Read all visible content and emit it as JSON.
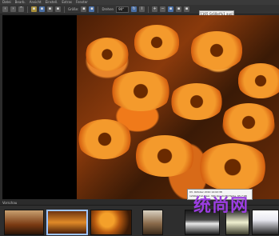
{
  "menu": {
    "items": [
      "Datei",
      "Bearb.",
      "Ansicht",
      "Einstell.",
      "Extras",
      "Fenster"
    ]
  },
  "toolbar": {
    "size_label": "Größe:",
    "rotate_label": "Drehen",
    "rotate_value": "90°"
  },
  "viewer": {
    "zoom_badge": "1165 Größe(%1 aus)"
  },
  "info": {
    "line1": "03. Oktober 2010 14:02:38",
    "line2": "1200x1712 Pixel, 300 dpi, 24 Bit Farbe, 65.7 KB"
  },
  "filmstrip": {
    "label": "Vorschau"
  },
  "watermark": {
    "text": "统尚网"
  },
  "colors": {
    "accent": "#4a6fa5",
    "watermark": "#9b3de0"
  }
}
